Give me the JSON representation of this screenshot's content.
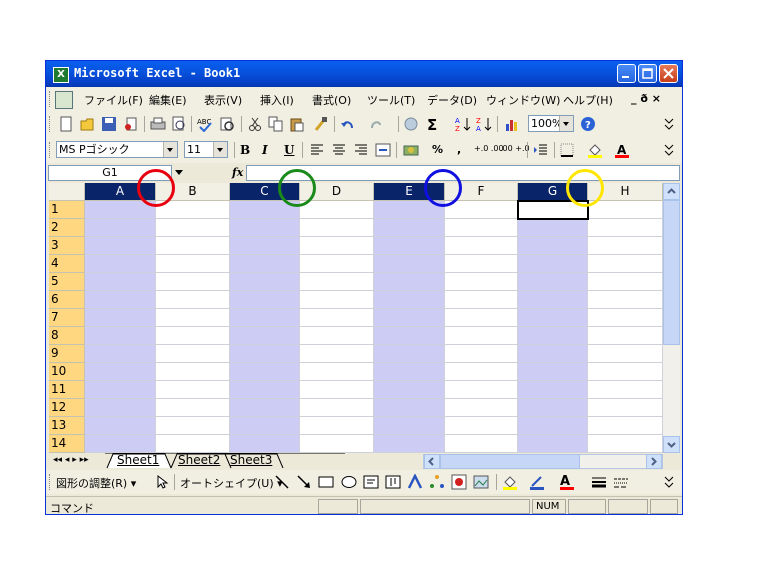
{
  "window": {
    "title": "Microsoft Excel - Book1",
    "icon_label": "X"
  },
  "menu": {
    "items": [
      "ファイル(F)",
      "編集(E)",
      "表示(V)",
      "挿入(I)",
      "書式(O)",
      "ツール(T)",
      "データ(D)",
      "ウィンドウ(W)",
      "ヘルプ(H)"
    ],
    "doc_controls": "_ ð ×"
  },
  "standard_toolbar": {
    "zoom": "100%"
  },
  "formatting_toolbar": {
    "font": "MS Pゴシック",
    "size": "11",
    "bold": "B",
    "italic": "I",
    "underline": "U",
    "percent": "%",
    "comma": ",",
    "inc_decimal": "+.0 .00",
    "dec_decimal": ".00 +.0"
  },
  "formula_bar": {
    "name_box": "G1",
    "fx": "fx",
    "formula": ""
  },
  "sheet": {
    "columns": [
      "A",
      "B",
      "C",
      "D",
      "E",
      "F",
      "G",
      "H"
    ],
    "selected_columns": [
      "A",
      "C",
      "E",
      "G"
    ],
    "rows": [
      "1",
      "2",
      "3",
      "4",
      "5",
      "6",
      "7",
      "8",
      "9",
      "10",
      "11",
      "12",
      "13",
      "14"
    ],
    "active_cell": "G1"
  },
  "sheet_tabs": {
    "nav": "◂◂ ◂ ▸ ▸▸",
    "tabs": [
      "Sheet1",
      "Sheet2",
      "Sheet3"
    ],
    "active": "Sheet1"
  },
  "drawing_toolbar": {
    "draw_menu": "図形の調整(R) ▾",
    "autoshape_menu": "オートシェイプ(U) ▾",
    "font_color_letter": "A"
  },
  "status": {
    "mode": "コマンド",
    "num": "NUM"
  },
  "annotations": {
    "circle_colors": [
      "#e8000f",
      "#1a8a1a",
      "#1010e0",
      "#ffe600"
    ]
  },
  "colors": {
    "title_blue": "#0753de",
    "selected_header": "#0a246a",
    "selected_fill": "#ccccf5",
    "row_header": "#ffd781"
  }
}
